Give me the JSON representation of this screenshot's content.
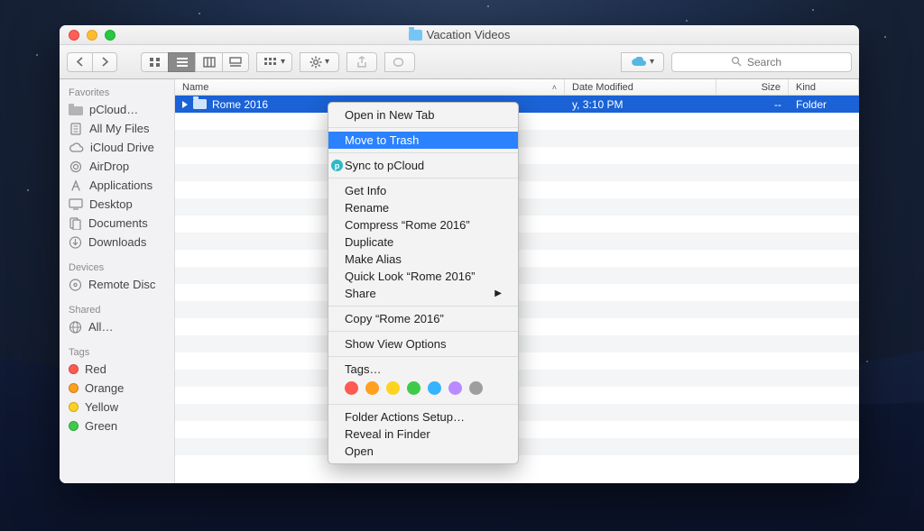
{
  "window": {
    "title": "Vacation Videos"
  },
  "toolbar": {
    "search_placeholder": "Search"
  },
  "columns": {
    "name": "Name",
    "date_modified": "Date Modified",
    "size": "Size",
    "kind": "Kind"
  },
  "sidebar": {
    "favorites_label": "Favorites",
    "devices_label": "Devices",
    "shared_label": "Shared",
    "tags_label": "Tags",
    "favorites": [
      {
        "label": "pCloud…"
      },
      {
        "label": "All My Files"
      },
      {
        "label": "iCloud Drive"
      },
      {
        "label": "AirDrop"
      },
      {
        "label": "Applications"
      },
      {
        "label": "Desktop"
      },
      {
        "label": "Documents"
      },
      {
        "label": "Downloads"
      }
    ],
    "devices": [
      {
        "label": "Remote Disc"
      }
    ],
    "shared": [
      {
        "label": "All…"
      }
    ],
    "tags": [
      {
        "label": "Red",
        "color": "#ff5a52"
      },
      {
        "label": "Orange",
        "color": "#ffa01f"
      },
      {
        "label": "Yellow",
        "color": "#ffd21f"
      },
      {
        "label": "Green",
        "color": "#3ecb4c"
      }
    ]
  },
  "files": {
    "row0": {
      "name": "Rome 2016",
      "date": "y, 3:10 PM",
      "size": "--",
      "kind": "Folder"
    }
  },
  "context_menu": {
    "open_new_tab": "Open in New Tab",
    "move_to_trash": "Move to Trash",
    "sync_pcloud": "Sync to pCloud",
    "get_info": "Get Info",
    "rename": "Rename",
    "compress": "Compress “Rome 2016”",
    "duplicate": "Duplicate",
    "make_alias": "Make Alias",
    "quick_look": "Quick Look “Rome 2016”",
    "share": "Share",
    "copy": "Copy “Rome 2016”",
    "show_view_options": "Show View Options",
    "tags": "Tags…",
    "tag_colors": [
      "#ff5a52",
      "#ffa01f",
      "#ffd21f",
      "#3ecb4c",
      "#36b3ff",
      "#b98bff",
      "#9e9e9e"
    ],
    "folder_actions": "Folder Actions Setup…",
    "reveal": "Reveal in Finder",
    "open": "Open"
  }
}
